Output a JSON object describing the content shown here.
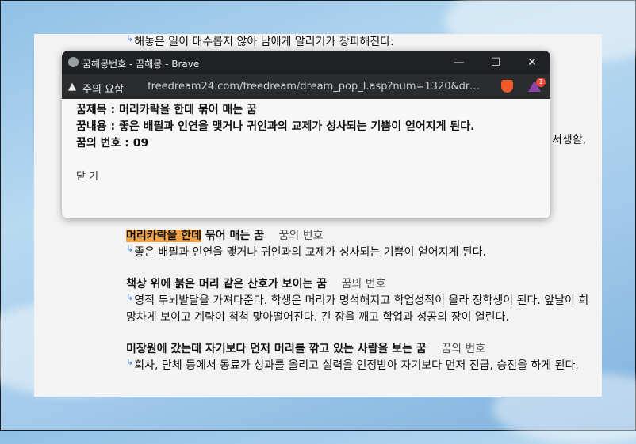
{
  "page": {
    "top_line": "해놓은 일이 대수롭지 않아 남에게 알리기가 창피해진다.",
    "cut_text": "서생활,",
    "entries": [
      {
        "title_highlight": "머리카락을 한데",
        "title_rest": " 묶어 매는 꿈",
        "num_link": "꿈의 번호",
        "desc": "좋은 배필과 인연을 맺거나 귀인과의 교제가 성사되는 기쁨이 얻어지게 된다."
      },
      {
        "title": "책상 위에 붉은 머리 같은 산호가 보이는 꿈",
        "num_link": "꿈의 번호",
        "desc": "영적 두뇌발달을 가져다준다. 학생은 머리가 명석해지고 학업성적이 올라 장학생이 된다. 앞날이 희망차게 보이고 계략이 척척 맞아떨어진다. 긴 잠을 깨고 학업과 성공의 장이 열린다."
      },
      {
        "title": "미장원에 갔는데 자기보다 먼저 머리를 깎고 있는 사람을 보는 꿈",
        "num_link": "꿈의 번호",
        "desc": "회사, 단체 등에서 동료가 성과를 올리고 실력을 인정받아 자기보다 먼저 진급, 승진을 하게 된다."
      }
    ]
  },
  "popup": {
    "window_title": "꿈해몽번호 - 꿈해몽 - Brave",
    "warning_label": "주의 요함",
    "url": "freedream24.com/freedream/dream_pop_l.asp?num=1320&drea...",
    "badge_count": "1",
    "dream_title_label": "꿈제목 : ",
    "dream_title": "머리카락을 한데 묶어 매는 꿈",
    "dream_content_label": "꿈내용 : ",
    "dream_content": "좋은 배필과 인연을 맺거나 귀인과의 교제가 성사되는 기쁨이 얻어지게 된다.",
    "dream_number_label": "꿈의 번호 : ",
    "dream_number": "09",
    "close_label": "닫 기"
  }
}
